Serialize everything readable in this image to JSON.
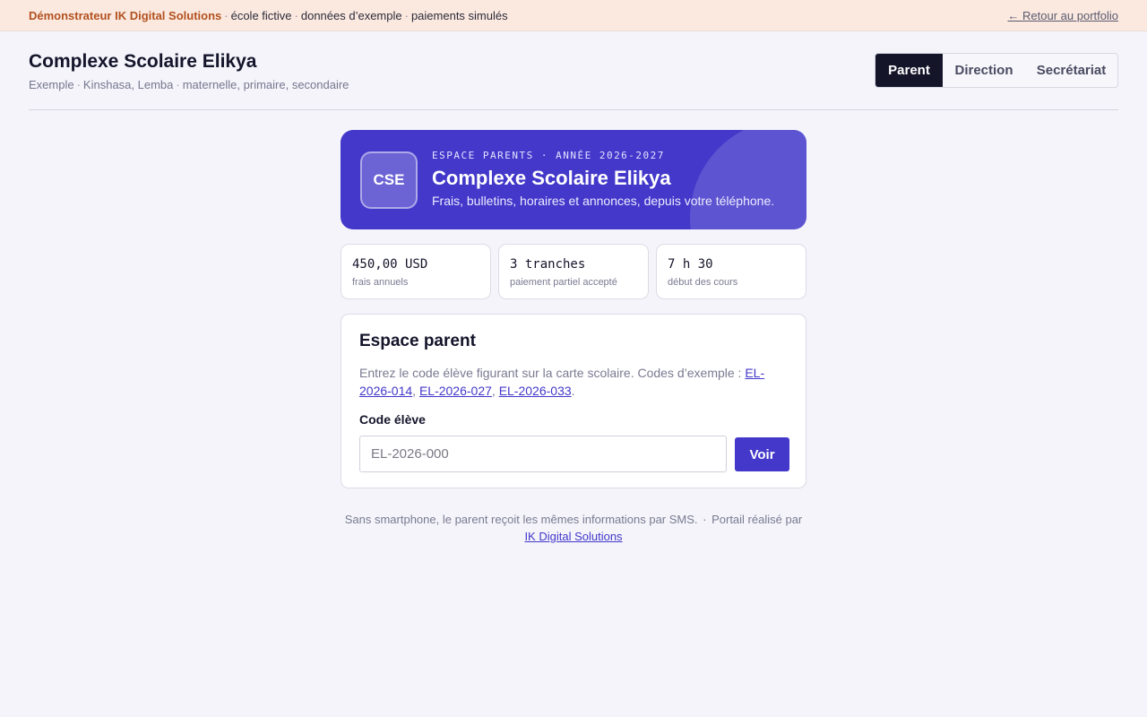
{
  "demo_bar": {
    "brand": "Démonstrateur IK Digital Solutions",
    "tags": [
      "école fictive",
      "données d’exemple",
      "paiements simulés"
    ],
    "back_link": "← Retour au portfolio"
  },
  "header": {
    "title": "Complexe Scolaire Elikya",
    "subtitle_parts": [
      "Exemple",
      "Kinshasa, Lemba",
      "maternelle, primaire, secondaire"
    ]
  },
  "role_tabs": [
    {
      "label": "Parent",
      "active": true
    },
    {
      "label": "Direction",
      "active": false
    },
    {
      "label": "Secrétariat",
      "active": false
    }
  ],
  "hero": {
    "logo_text": "CSE",
    "eyebrow": "ESPACE PARENTS · ANNÉE 2026-2027",
    "title": "Complexe Scolaire Elikya",
    "description": "Frais, bulletins, horaires et annonces, depuis votre téléphone."
  },
  "stats": [
    {
      "value": "450,00 USD",
      "label": "frais annuels"
    },
    {
      "value": "3 tranches",
      "label": "paiement partiel accepté"
    },
    {
      "value": "7 h 30",
      "label": "début des cours"
    }
  ],
  "parent_form": {
    "title": "Espace parent",
    "help_prefix": "Entrez le code élève figurant sur la carte scolaire. Codes d’exemple : ",
    "example_codes": [
      "EL-2026-014",
      "EL-2026-027",
      "EL-2026-033"
    ],
    "help_suffix": ".",
    "code_label": "Code élève",
    "code_value": "",
    "code_placeholder": "EL-2026-000",
    "submit_label": "Voir"
  },
  "footer": {
    "sms_note": "Sans smartphone, le parent reçoit les mêmes informations par SMS.",
    "credit_prefix": "Portail réalisé par ",
    "credit_link": "IK Digital Solutions"
  },
  "colors": {
    "accent": "#4338ca",
    "dark": "#15152a",
    "banner_bg": "#fbe9e0",
    "banner_brand": "#b2511f",
    "page_bg": "#f4f4fa"
  }
}
